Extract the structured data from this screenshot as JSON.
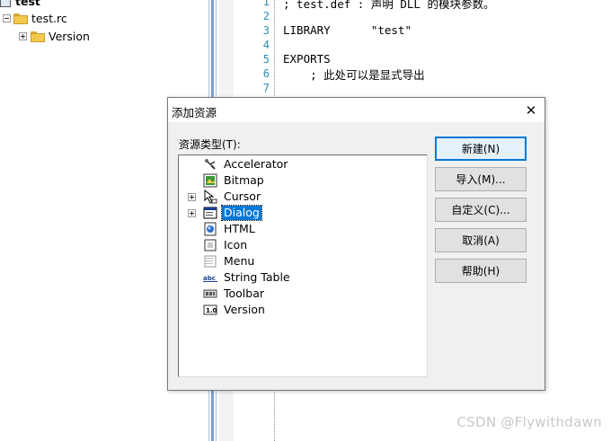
{
  "tree": {
    "root_label": "test",
    "file_label": "test.rc",
    "folder_label": "Version"
  },
  "editor": {
    "lines": [
      {
        "no": "1",
        "text": "; test.def : 声明 DLL 的模块参数。"
      },
      {
        "no": "2",
        "text": ""
      },
      {
        "no": "3",
        "text": "LIBRARY      \"test\""
      },
      {
        "no": "4",
        "text": ""
      },
      {
        "no": "5",
        "text": "EXPORTS"
      },
      {
        "no": "6",
        "text": "    ; 此处可以是显式导出"
      },
      {
        "no": "7",
        "text": ""
      }
    ]
  },
  "dialog": {
    "title": "添加资源",
    "close_glyph": "✕",
    "list_label": "资源类型(T):",
    "resource_types": [
      {
        "label": "Accelerator",
        "icon": "accelerator-icon",
        "expandable": false
      },
      {
        "label": "Bitmap",
        "icon": "bitmap-icon",
        "expandable": false
      },
      {
        "label": "Cursor",
        "icon": "cursor-icon",
        "expandable": true
      },
      {
        "label": "Dialog",
        "icon": "dialog-icon",
        "expandable": true,
        "selected": true
      },
      {
        "label": "HTML",
        "icon": "html-icon",
        "expandable": false
      },
      {
        "label": "Icon",
        "icon": "icon-resource-icon",
        "expandable": false
      },
      {
        "label": "Menu",
        "icon": "menu-icon",
        "expandable": false
      },
      {
        "label": "String Table",
        "icon": "string-table-icon",
        "expandable": false
      },
      {
        "label": "Toolbar",
        "icon": "toolbar-icon",
        "expandable": false
      },
      {
        "label": "Version",
        "icon": "version-icon",
        "expandable": false
      }
    ],
    "buttons": {
      "new": "新建(N)",
      "import": "导入(M)...",
      "custom": "自定义(C)...",
      "cancel": "取消(A)",
      "help": "帮助(H)"
    }
  },
  "watermark": "CSDN @Flywithdawn",
  "colors": {
    "selection": "#0078d7",
    "line_numbers": "#2b91af",
    "dialog_bg": "#f0f0f0"
  }
}
